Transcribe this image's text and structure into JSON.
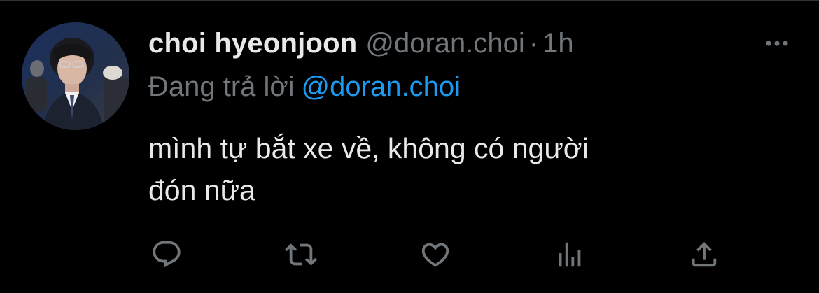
{
  "tweet": {
    "display_name": "choi hyeonjoon",
    "handle": "@doran.choi",
    "separator": "·",
    "time": "1h",
    "reply_prefix": "Đang trả lời",
    "reply_to": "@doran.choi",
    "text_line1": "mình tự bắt xe về, không có người",
    "text_line2": "đón nữa"
  },
  "icons": {
    "more": "more-horizontal-icon",
    "reply": "reply-bubble-icon",
    "retweet": "retweet-icon",
    "like": "heart-icon",
    "analytics": "bar-chart-icon",
    "share": "share-upload-icon"
  },
  "colors": {
    "background": "#000000",
    "primary_text": "#e7e9ea",
    "secondary_text": "#71767b",
    "link": "#1d9bf0"
  }
}
